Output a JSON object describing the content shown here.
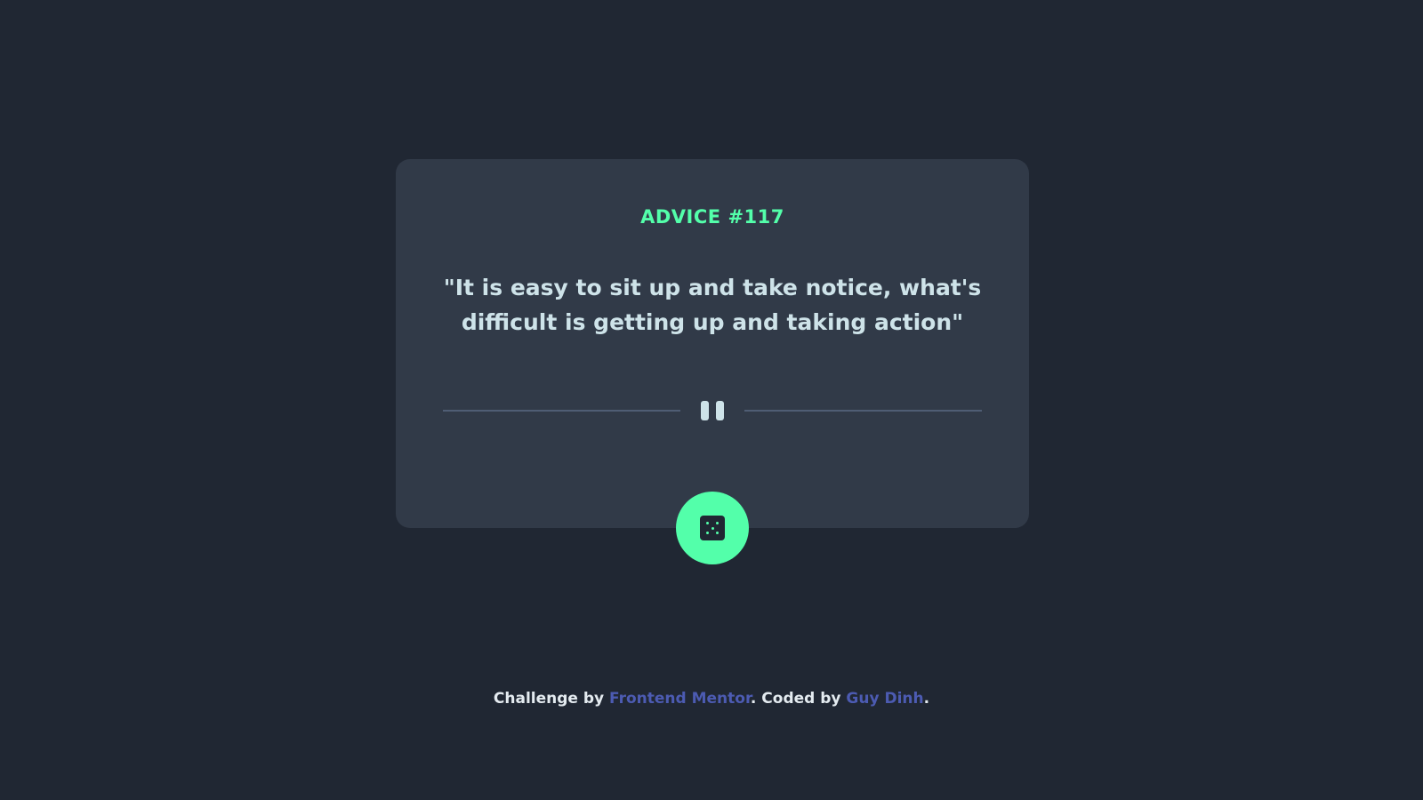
{
  "card": {
    "advice_id": "ADVICE #117",
    "advice_text": "\"It is easy to sit up and take notice, what's difficult is getting up and taking action\""
  },
  "divider": {
    "icon": "pause-icon"
  },
  "dice_button": {
    "icon": "dice-icon"
  },
  "footer": {
    "prefix": "Challenge by ",
    "link1": "Frontend Mentor",
    "middle": ". Coded by ",
    "link2": "Guy Dinh",
    "suffix": "."
  },
  "colors": {
    "background": "#202733",
    "card": "#313a48",
    "accent": "#53ffaa",
    "text": "#cee3e9",
    "link": "#4c5bb2"
  }
}
